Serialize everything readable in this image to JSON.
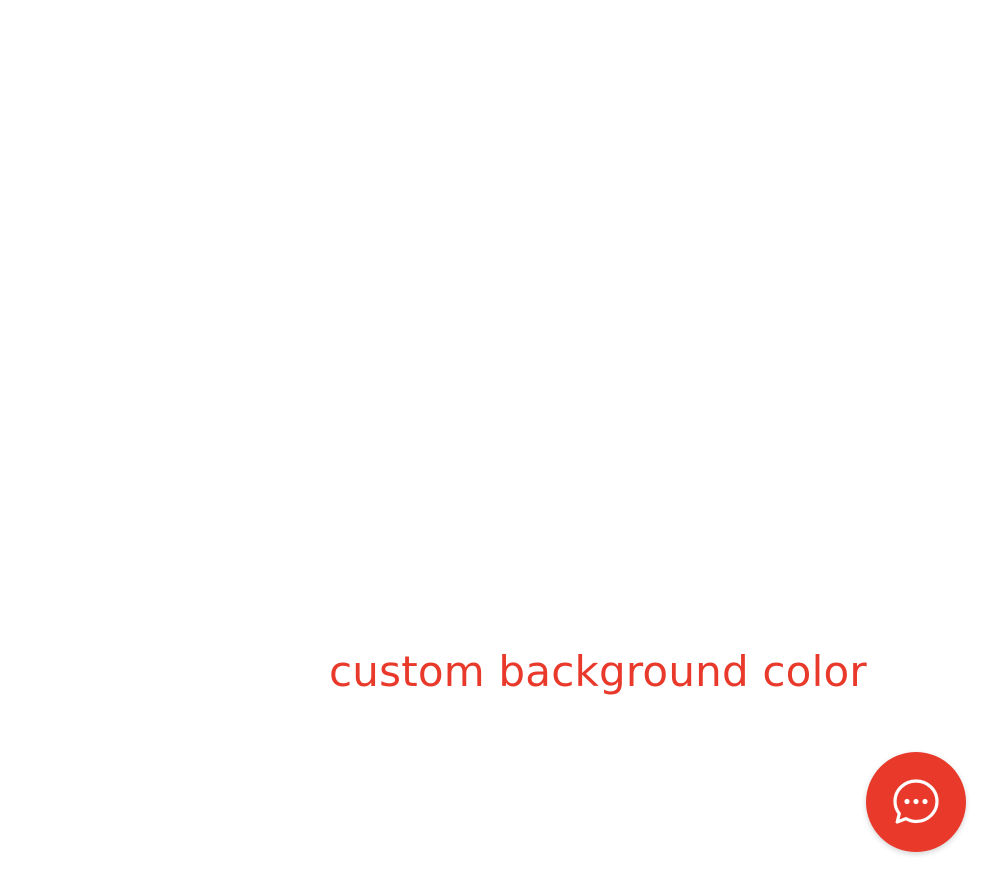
{
  "main": {
    "label": "custom background color"
  },
  "chat_button": {
    "icon": "chat-bubble-icon",
    "color": "#e8392b"
  },
  "colors": {
    "accent": "#e8392b",
    "background": "#ffffff"
  }
}
